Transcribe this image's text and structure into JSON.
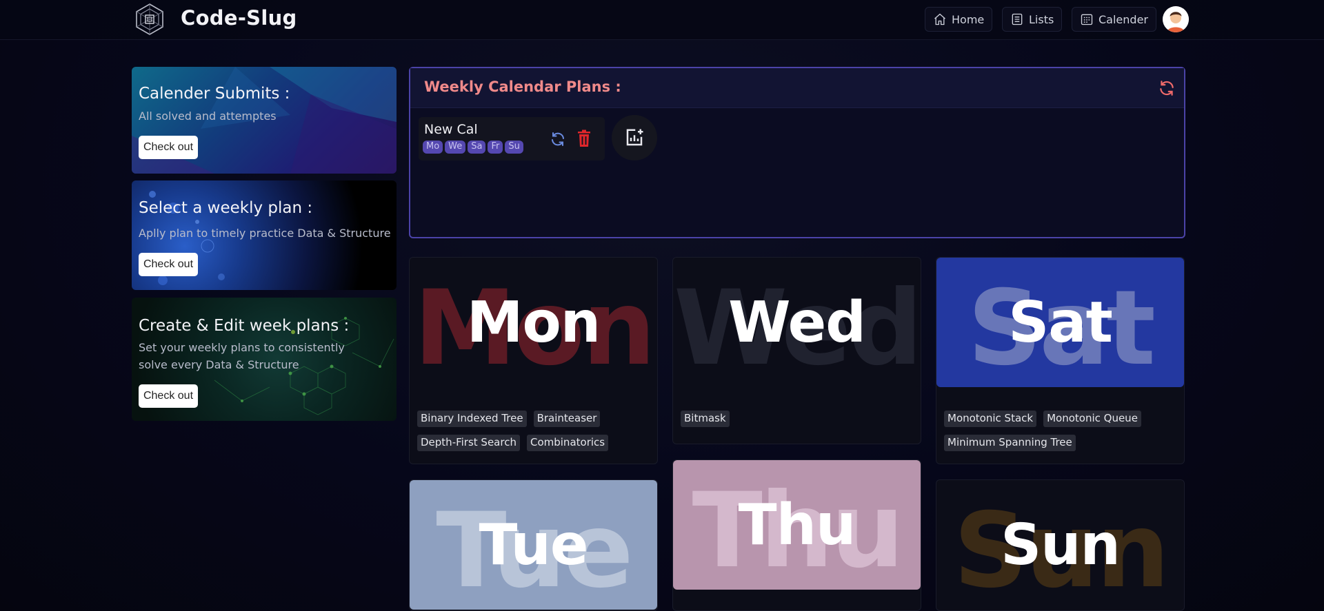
{
  "app": {
    "brand": "Code-Slug",
    "nav": [
      {
        "label": "Home",
        "icon": "home-icon"
      },
      {
        "label": "Lists",
        "icon": "list-icon"
      },
      {
        "label": "Calender",
        "icon": "calendar-icon"
      }
    ]
  },
  "sidebar": {
    "cards": [
      {
        "title": "Calender Submits :",
        "text": "All solved and attemptes",
        "button": "Check out"
      },
      {
        "title": "Select a weekly plan :",
        "text": "Aplly plan to timely practice Data & Structure",
        "button": "Check out"
      },
      {
        "title": "Create & Edit week plans :",
        "text": "Set your weekly plans to consistently solve every Data & Structure",
        "button": "Check out"
      }
    ]
  },
  "plans": {
    "title": "Weekly Calendar Plans :",
    "items": [
      {
        "name": "New Cal",
        "days": [
          "Mo",
          "We",
          "Sa",
          "Fr",
          "Su"
        ]
      }
    ]
  },
  "days": {
    "mon": {
      "label": "Mon",
      "topics": [
        "Binary Indexed Tree",
        "Brainteaser",
        "Depth-First Search",
        "Combinatorics"
      ]
    },
    "wed": {
      "label": "Wed",
      "topics": [
        "Bitmask"
      ]
    },
    "sat": {
      "label": "Sat",
      "topics": [
        "Monotonic Stack",
        "Monotonic Queue",
        "Minimum Spanning Tree"
      ]
    },
    "tue": {
      "label": "Tue",
      "topics": []
    },
    "thu": {
      "label": "Thu",
      "topics": []
    },
    "sun": {
      "label": "Sun",
      "topics": []
    }
  },
  "colors": {
    "plans_title": "#f08a8a",
    "plans_border": "#4b43a8",
    "day_tag": "#5548b0",
    "delete": "#e0262b",
    "sync": "#6a8be0"
  }
}
